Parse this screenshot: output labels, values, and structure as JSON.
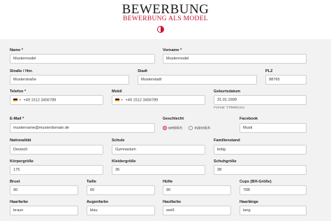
{
  "header": {
    "title": "BEWERBUNG",
    "subtitle": "BEWERBUNG ALS MODEL"
  },
  "colors": {
    "accent": "#c8102e",
    "form_bg": "#f2f2f2"
  },
  "fields": {
    "name": {
      "label": "Name *",
      "value": "Mustermodel"
    },
    "vorname": {
      "label": "Vorname *",
      "value": "Mustermodel"
    },
    "strasse": {
      "label": "Straße / Hnr.",
      "value": "Musterstraße"
    },
    "stadt": {
      "label": "Stadt",
      "value": "Musterstadt"
    },
    "plz": {
      "label": "PLZ",
      "value": "98765"
    },
    "telefon": {
      "label": "Telefon *",
      "value": "+49 1512 3456789"
    },
    "mobil": {
      "label": "Mobil",
      "value": "+49 1512 3456789"
    },
    "geburtsdatum": {
      "label": "Geburtsdatum",
      "value": "31.01.1999",
      "hint": "Format: TT/MM/JJJJ"
    },
    "email": {
      "label": "E-Mail *",
      "value": "mustername@musterdomain.de"
    },
    "geschlecht": {
      "label": "Geschlecht",
      "options": [
        "weiblich",
        "männlich"
      ],
      "selected": "weiblich"
    },
    "facebook": {
      "label": "Facebook",
      "value": "Musti"
    },
    "nationalitaet": {
      "label": "Nationalität",
      "value": "Deutsch"
    },
    "schule": {
      "label": "Schule",
      "value": "Gymnasium"
    },
    "familienstand": {
      "label": "Familienstand",
      "value": "ledig"
    },
    "koerpergroesse": {
      "label": "Körpergröße",
      "value": "175"
    },
    "kleidergroesse": {
      "label": "Kleidergröße",
      "value": "36"
    },
    "schuhgroesse": {
      "label": "Schuhgröße",
      "value": "38"
    },
    "brust": {
      "label": "Brust",
      "value": "90"
    },
    "taille": {
      "label": "Taille",
      "value": "60"
    },
    "huefte": {
      "label": "Hüfte",
      "value": "90"
    },
    "cups": {
      "label": "Cups (BH-Größe)",
      "value": "70B"
    },
    "haarfarbe": {
      "label": "Haarfarbe",
      "value": "braun"
    },
    "augenfarbe": {
      "label": "Augenfarbe",
      "value": "blau"
    },
    "hautfarbe": {
      "label": "Hautfarbe",
      "value": "weiß"
    },
    "haarlaenge": {
      "label": "Haarlänge",
      "value": "lang"
    }
  }
}
